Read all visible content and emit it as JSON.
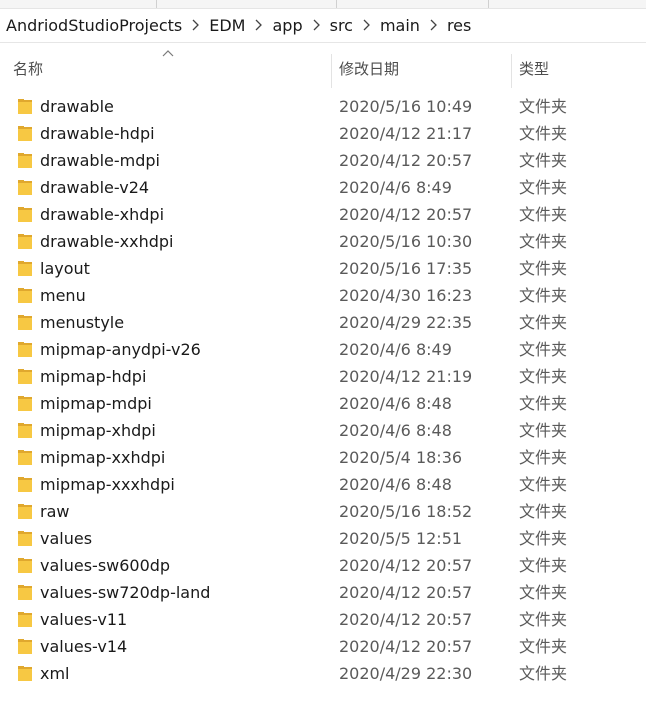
{
  "breadcrumb": [
    "AndriodStudioProjects",
    "EDM",
    "app",
    "src",
    "main",
    "res"
  ],
  "columns": {
    "name": "名称",
    "date": "修改日期",
    "type": "类型"
  },
  "rows": [
    {
      "name": "drawable",
      "date": "2020/5/16 10:49",
      "type": "文件夹"
    },
    {
      "name": "drawable-hdpi",
      "date": "2020/4/12 21:17",
      "type": "文件夹"
    },
    {
      "name": "drawable-mdpi",
      "date": "2020/4/12 20:57",
      "type": "文件夹"
    },
    {
      "name": "drawable-v24",
      "date": "2020/4/6 8:49",
      "type": "文件夹"
    },
    {
      "name": "drawable-xhdpi",
      "date": "2020/4/12 20:57",
      "type": "文件夹"
    },
    {
      "name": "drawable-xxhdpi",
      "date": "2020/5/16 10:30",
      "type": "文件夹"
    },
    {
      "name": "layout",
      "date": "2020/5/16 17:35",
      "type": "文件夹"
    },
    {
      "name": "menu",
      "date": "2020/4/30 16:23",
      "type": "文件夹"
    },
    {
      "name": "menustyle",
      "date": "2020/4/29 22:35",
      "type": "文件夹"
    },
    {
      "name": "mipmap-anydpi-v26",
      "date": "2020/4/6 8:49",
      "type": "文件夹"
    },
    {
      "name": "mipmap-hdpi",
      "date": "2020/4/12 21:19",
      "type": "文件夹"
    },
    {
      "name": "mipmap-mdpi",
      "date": "2020/4/6 8:48",
      "type": "文件夹"
    },
    {
      "name": "mipmap-xhdpi",
      "date": "2020/4/6 8:48",
      "type": "文件夹"
    },
    {
      "name": "mipmap-xxhdpi",
      "date": "2020/5/4 18:36",
      "type": "文件夹"
    },
    {
      "name": "mipmap-xxxhdpi",
      "date": "2020/4/6 8:48",
      "type": "文件夹"
    },
    {
      "name": "raw",
      "date": "2020/5/16 18:52",
      "type": "文件夹"
    },
    {
      "name": "values",
      "date": "2020/5/5 12:51",
      "type": "文件夹"
    },
    {
      "name": "values-sw600dp",
      "date": "2020/4/12 20:57",
      "type": "文件夹"
    },
    {
      "name": "values-sw720dp-land",
      "date": "2020/4/12 20:57",
      "type": "文件夹"
    },
    {
      "name": "values-v11",
      "date": "2020/4/12 20:57",
      "type": "文件夹"
    },
    {
      "name": "values-v14",
      "date": "2020/4/12 20:57",
      "type": "文件夹"
    },
    {
      "name": "xml",
      "date": "2020/4/29 22:30",
      "type": "文件夹"
    }
  ],
  "icons": {
    "folder": "folder-icon",
    "crumb_separator": "chevron-right-icon",
    "sort": "sort-ascending-icon"
  },
  "colors": {
    "folder_front": "#f7c843",
    "folder_back": "#e0a82e",
    "header_text": "#4d4d4d",
    "secondary_text": "#5a5a5a"
  }
}
